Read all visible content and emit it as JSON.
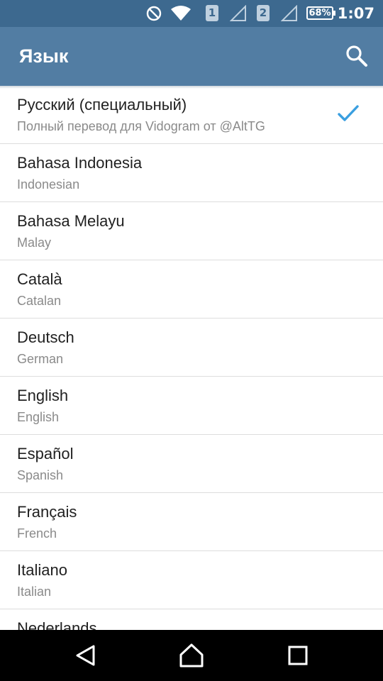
{
  "status_bar": {
    "time": "1:07",
    "battery": "68%",
    "sim1": "1",
    "sim2": "2",
    "icons": [
      "do-not-disturb-icon",
      "wifi-icon",
      "signal-icon",
      "signal-icon",
      "battery-icon"
    ]
  },
  "appbar": {
    "title": "Язык",
    "search_icon": "search-icon"
  },
  "colors": {
    "status_bar": "#3d698f",
    "appbar": "#527da3",
    "checkmark": "#3a9fe0"
  },
  "languages": [
    {
      "name": "Русский (специальный)",
      "subtitle": "Полный перевод для Vidogram от @AltTG",
      "selected": true
    },
    {
      "name": "Bahasa Indonesia",
      "subtitle": "Indonesian"
    },
    {
      "name": "Bahasa Melayu",
      "subtitle": "Malay"
    },
    {
      "name": "Català",
      "subtitle": "Catalan"
    },
    {
      "name": "Deutsch",
      "subtitle": "German"
    },
    {
      "name": "English",
      "subtitle": "English"
    },
    {
      "name": "Español",
      "subtitle": "Spanish"
    },
    {
      "name": "Français",
      "subtitle": "French"
    },
    {
      "name": "Italiano",
      "subtitle": "Italian"
    },
    {
      "name": "Nederlands",
      "subtitle": ""
    }
  ],
  "nav_bar": [
    "back-icon",
    "home-icon",
    "recents-icon"
  ]
}
